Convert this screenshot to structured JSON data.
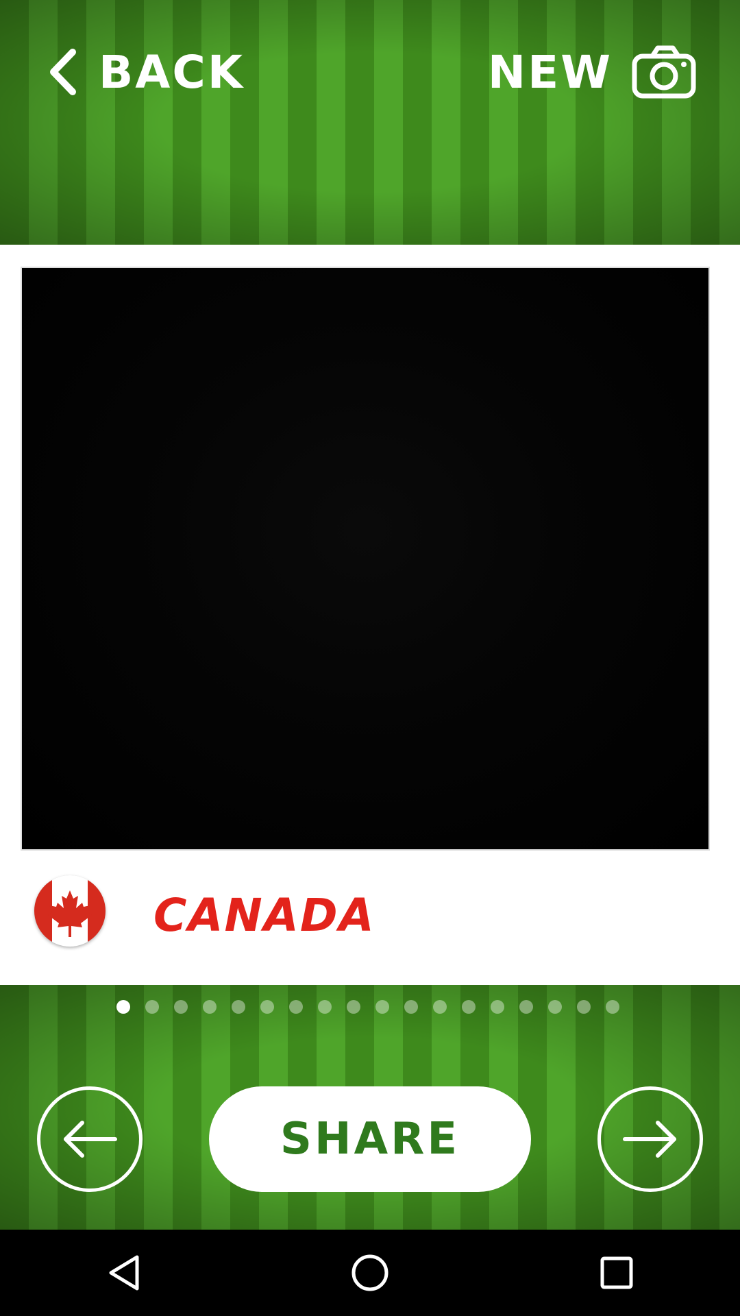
{
  "header": {
    "back_label": "BACK",
    "new_label": "NEW"
  },
  "card": {
    "country_name": "CANADA",
    "flag_icon": "canada-flag-icon"
  },
  "carousel": {
    "total_pages": 18,
    "active_index": 0
  },
  "footer": {
    "share_label": "SHARE",
    "prev_icon": "arrow-left-icon",
    "next_icon": "arrow-right-icon"
  },
  "navigation": {
    "back_icon": "nav-back-icon",
    "home_icon": "nav-home-icon",
    "recents_icon": "nav-recents-icon"
  },
  "colors": {
    "country_text": "#e3231b",
    "share_text": "#2f7a1d",
    "grass_dark": "#3e8a1c",
    "grass_light": "#4fa52a"
  }
}
